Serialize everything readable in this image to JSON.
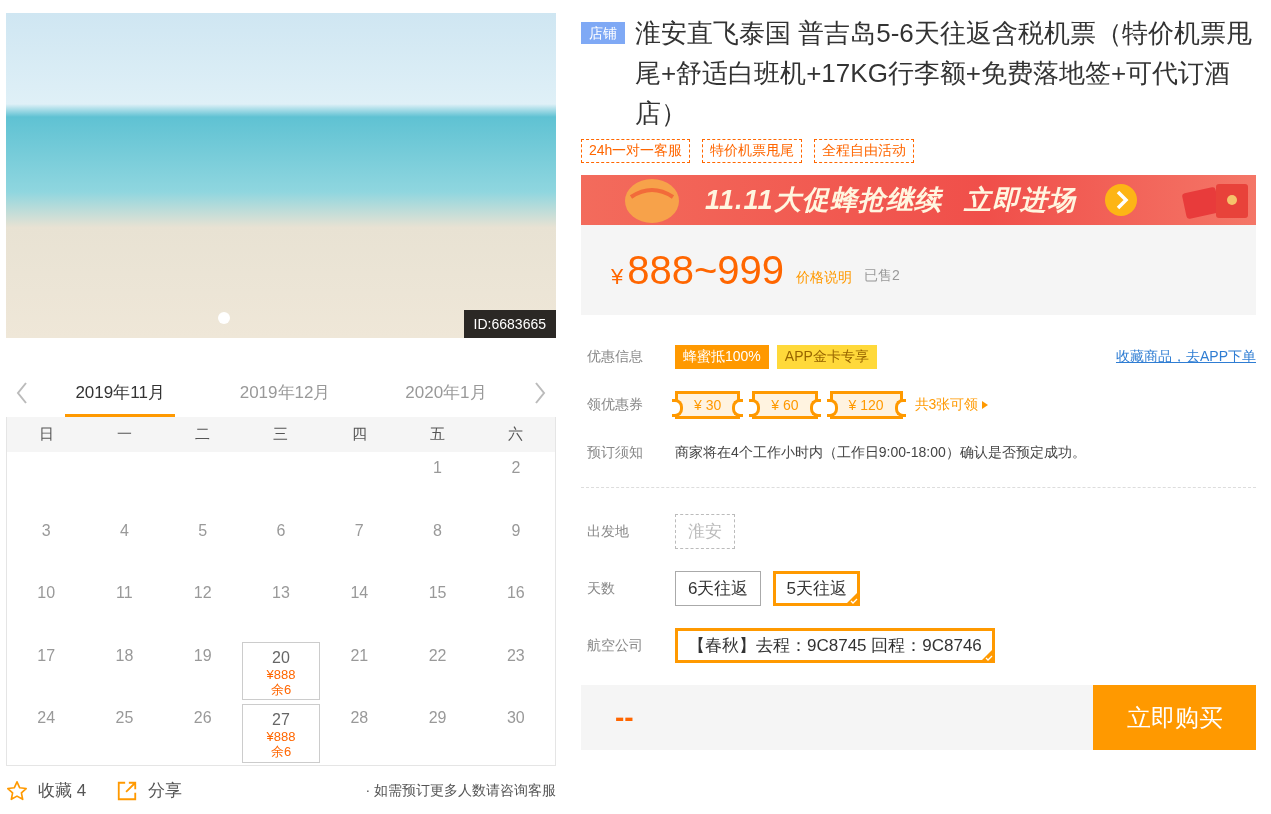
{
  "gallery": {
    "id_badge": "ID:6683665"
  },
  "calendar": {
    "months": [
      {
        "label": "2019年11月",
        "selected": true
      },
      {
        "label": "2019年12月",
        "selected": false
      },
      {
        "label": "2020年1月",
        "selected": false
      }
    ],
    "weekdays": [
      "日",
      "一",
      "二",
      "三",
      "四",
      "五",
      "六"
    ],
    "weeks": [
      [
        {
          "day": "1"
        },
        {
          "day": "2"
        }
      ],
      [
        {
          "day": "3"
        },
        {
          "day": "4"
        },
        {
          "day": "5"
        },
        {
          "day": "6"
        },
        {
          "day": "7"
        },
        {
          "day": "8"
        },
        {
          "day": "9"
        }
      ],
      [
        {
          "day": "10"
        },
        {
          "day": "11"
        },
        {
          "day": "12"
        },
        {
          "day": "13"
        },
        {
          "day": "14"
        },
        {
          "day": "15"
        },
        {
          "day": "16"
        }
      ],
      [
        {
          "day": "17"
        },
        {
          "day": "18"
        },
        {
          "day": "19"
        },
        {
          "day": "20",
          "price": "¥888",
          "stock": "余6"
        },
        {
          "day": "21"
        },
        {
          "day": "22"
        },
        {
          "day": "23"
        }
      ],
      [
        {
          "day": "24"
        },
        {
          "day": "25"
        },
        {
          "day": "26"
        },
        {
          "day": "27",
          "price": "¥888",
          "stock": "余6"
        },
        {
          "day": "28"
        },
        {
          "day": "29"
        },
        {
          "day": "30"
        }
      ]
    ]
  },
  "footer": {
    "favorite": "收藏 4",
    "share": "分享",
    "note": "· 如需预订更多人数请咨询客服"
  },
  "product": {
    "store_badge": "店铺",
    "title": "淮安直飞泰国 普吉岛5-6天往返含税机票（特价机票甩尾+舒适白班机+17KG行李额+免费落地签+可代订酒店）",
    "tags": [
      "24h一对一客服",
      "特价机票甩尾",
      "全程自由活动"
    ],
    "banner": {
      "text": "11.11大促蜂抢继续",
      "cta": "立即进场"
    },
    "price": {
      "currency": "¥",
      "range": "888~999",
      "note": "价格说明",
      "sold": "已售2"
    },
    "promotions": {
      "label": "优惠信息",
      "badges": [
        {
          "text": "蜂蜜抵100%",
          "kind": "solid"
        },
        {
          "text": "APP金卡专享",
          "kind": "gold"
        }
      ],
      "link": "收藏商品，去APP下单"
    },
    "coupons": {
      "label": "领优惠券",
      "items": [
        "¥ 30",
        "¥ 60",
        "¥ 120"
      ],
      "more": "共3张可领"
    },
    "notice": {
      "label": "预订须知",
      "text": "商家将在4个工作小时内（工作日9:00-18:00）确认是否预定成功。"
    },
    "options": [
      {
        "label": "出发地",
        "choices": [
          {
            "text": "淮安",
            "selected": false,
            "disabled": true
          }
        ]
      },
      {
        "label": "天数",
        "choices": [
          {
            "text": "6天往返",
            "selected": false,
            "disabled": false
          },
          {
            "text": "5天往返",
            "selected": true,
            "disabled": false
          }
        ]
      },
      {
        "label": "航空公司",
        "choices": [
          {
            "text": "【春秋】去程：9C8745 回程：9C8746",
            "selected": true,
            "disabled": false
          }
        ]
      }
    ],
    "buy_bar": {
      "total": "--",
      "button": "立即购买"
    }
  }
}
